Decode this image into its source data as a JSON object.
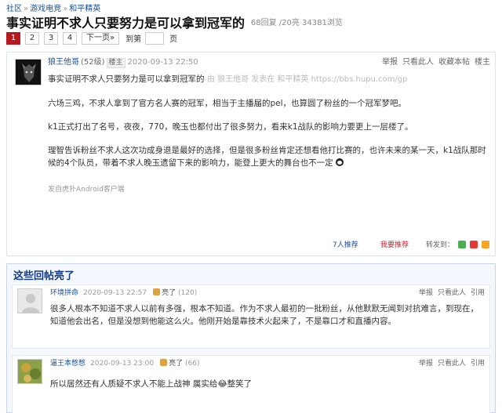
{
  "breadcrumb": [
    "社区",
    "游戏电竞",
    "和平精英"
  ],
  "thread": {
    "title": "事实证明不求人只要努力是可以拿到冠军的",
    "stats": "68回复 /20亮  34381浏览"
  },
  "pager": {
    "pages": [
      "1",
      "2",
      "3",
      "4"
    ],
    "next": "下一页»",
    "goto_label": "到第",
    "goto_suffix": "页"
  },
  "post": {
    "author": "狼王他哥",
    "level": "(52级)",
    "badge": "楼主",
    "time": "2020-09-13 22:50",
    "actions": [
      "举报",
      "只看此人",
      "收藏本帖",
      "楼主"
    ],
    "body_title": "事实证明不求人只要努力是可以拿到冠军的",
    "source": "由  狼王他哥 发表在 和平精英 https://bbs.hupu.com/gp",
    "paragraphs": [
      "六场三鸡，不求人拿到了官方名人赛的冠军，相当于主播届的pel，也算圆了粉丝的一个冠军梦吧。",
      "k1正式打出了名号，夜夜，770，晚玉也都付出了很多努力，看来k1战队的影响力要更上一层楼了。",
      "理智告诉粉丝不求人这次功成身退是最好的选择，但是很多粉丝肯定还想看他打比赛的，也许未来的某一天，k1战队那时候的4个队员，带着不求人晚玉遗留下来的影响力，能登上更大的舞台也不一定"
    ],
    "from": "发自虎扑Android客户端",
    "recs": "7人推荐",
    "rec_button": "我要推荐",
    "share_label": "转发到："
  },
  "hot": {
    "title": "这些回帖亮了",
    "replies": [
      {
        "author": "环境拼命",
        "time": "2020-09-13 22:57",
        "light": "亮了",
        "count": "(120)",
        "actions": [
          "举报",
          "只看此人",
          "引用"
        ],
        "body": "很多人根本不知道不求人以前有多强，根本不知道。作为不求人最初的一批粉丝，从他默默无闻到对抗难言，到现在，知道他会出名，但是没想到他能这么火。他刚开始是靠技术火起来了，不是靠口才和直播内容。"
      },
      {
        "author": "逼王本憋憋",
        "time": "2020-09-13 23:00",
        "light": "亮了",
        "count": "(66)",
        "actions": [
          "举报",
          "只看此人",
          "引用"
        ],
        "body": "所以居然还有人质疑不求人不能上战神 属实给😂整笑了"
      }
    ]
  },
  "colors": {
    "brand_red": "#b7181d",
    "link_blue": "#1a4f9c",
    "hot_title": "#0f3b8a"
  }
}
